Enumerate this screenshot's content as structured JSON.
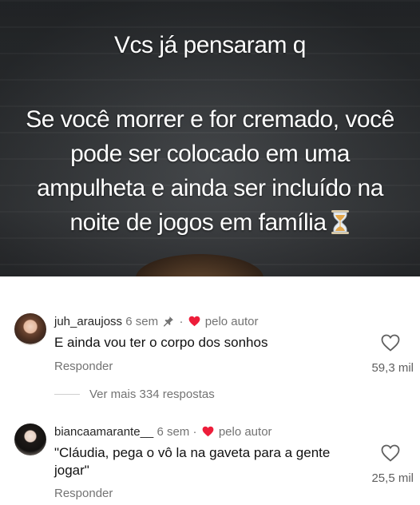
{
  "meme": {
    "title": "Vcs já pensaram q",
    "lines": [
      "Se você morrer e for cremado, você",
      "pode ser colocado em uma",
      "ampulheta e ainda ser incluído na",
      "noite de jogos em família"
    ],
    "emoji_icon": "hourglass-icon"
  },
  "comments": [
    {
      "username": "juh_araujoss",
      "time": "6 sem",
      "pinned": true,
      "author_label": "pelo autor",
      "text": "E ainda vou ter o corpo dos sonhos",
      "reply_label": "Responder",
      "likes": "59,3 mil",
      "more_replies": "Ver mais 334 respostas"
    },
    {
      "username": "biancaamarante__",
      "time": "6 sem",
      "author_label": "pelo autor",
      "text_line1": "\"Cláudia, pega o vô la na gaveta para a gente",
      "text_line2": "jogar\"",
      "reply_label": "Responder",
      "likes": "25,5 mil"
    }
  ],
  "colors": {
    "heart_red": "#ed1d3a",
    "text_primary": "#262626",
    "text_secondary": "#737373"
  }
}
